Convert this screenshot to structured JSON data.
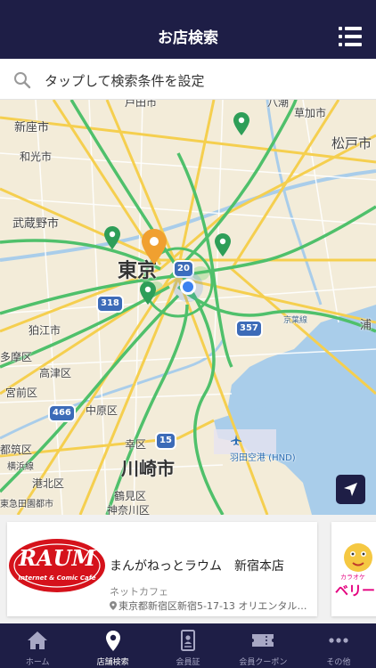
{
  "header": {
    "title": "お店検索"
  },
  "search": {
    "placeholder": "タップして検索条件を設定"
  },
  "map": {
    "labels": {
      "toda": "戸田市",
      "yashio": "八潮",
      "soka": "草加市",
      "niiza": "新座市",
      "wako": "和光市",
      "matsudo": "松戸市",
      "musashino": "武蔵野市",
      "tokyo": "東京",
      "komae": "狛江市",
      "tama": "多摩区",
      "takatsu": "高津区",
      "miyamae": "宮前区",
      "tsuzuki": "都筑区",
      "kohoku": "港北区",
      "yokohama": "横浜線",
      "tokyu": "東急田園都市",
      "nakahara": "中原区",
      "saiwai": "幸区",
      "kawasaki": "川崎市",
      "tsurumi": "鶴見区",
      "kanagawa": "神奈川区",
      "airport": "羽田空港 (HND)",
      "keiyo": "京葉線",
      "urayasu": "浦"
    },
    "routes": {
      "r20": "20",
      "r318": "318",
      "r357": "357",
      "r466": "466",
      "r15": "15"
    }
  },
  "shop_card": {
    "name": "まんがねっとラウム　新宿本店",
    "category": "ネットカフェ",
    "address": "東京都新宿区新宿5-17-13 オリエンタルビル",
    "logo_text": "RAUM",
    "logo_sub": "Internet & Comic Cafe"
  },
  "next_card": {
    "logo_top": "カラオケ",
    "logo_brand": "ベリー"
  },
  "tabbar": {
    "items": [
      {
        "label": "ホーム"
      },
      {
        "label": "店舗検索"
      },
      {
        "label": "会員証"
      },
      {
        "label": "会員クーポン"
      },
      {
        "label": "その他"
      }
    ]
  },
  "colors": {
    "navy": "#1e1e46",
    "green_pin": "#2e9e58",
    "orange_pin": "#f0a030",
    "accent_blue": "#3b82f0"
  }
}
